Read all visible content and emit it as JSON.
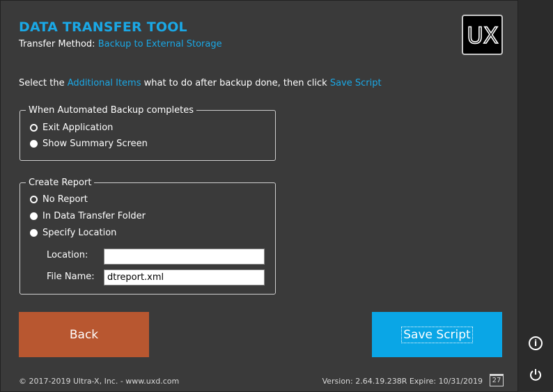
{
  "header": {
    "title": "DATA TRANSFER TOOL",
    "method_label": "Transfer Method: ",
    "method_value": "Backup to External Storage",
    "logo_text": "UX"
  },
  "instruction": {
    "part1": "Select the ",
    "highlight1": "Additional Items",
    "part2": " what to do after backup done, then click ",
    "highlight2": "Save Script"
  },
  "backup_group": {
    "legend": "When Automated Backup completes",
    "options": [
      {
        "label": "Exit Application",
        "selected": true
      },
      {
        "label": "Show Summary Screen",
        "selected": false
      }
    ]
  },
  "report_group": {
    "legend": "Create Report",
    "options": [
      {
        "label": "No Report",
        "selected": true
      },
      {
        "label": "In Data Transfer Folder",
        "selected": false
      },
      {
        "label": "Specify Location",
        "selected": false
      }
    ],
    "location_label": "Location:",
    "location_value": "",
    "filename_label": "File Name:",
    "filename_value": "dtreport.xml"
  },
  "buttons": {
    "back": "Back",
    "save": "Save Script"
  },
  "footer": {
    "copyright": "© 2017-2019 Ultra-X, Inc. - www.uxd.com",
    "version": "Version: 2.64.19.238R Expire: 10/31/2019",
    "calendar_day": "27"
  },
  "side": {
    "info_icon": "info-icon",
    "power_icon": "power-icon"
  },
  "colors": {
    "accent": "#1aa8e6",
    "back_button": "#b85730",
    "save_button": "#0aa6e6",
    "background": "#3a3a3a"
  }
}
